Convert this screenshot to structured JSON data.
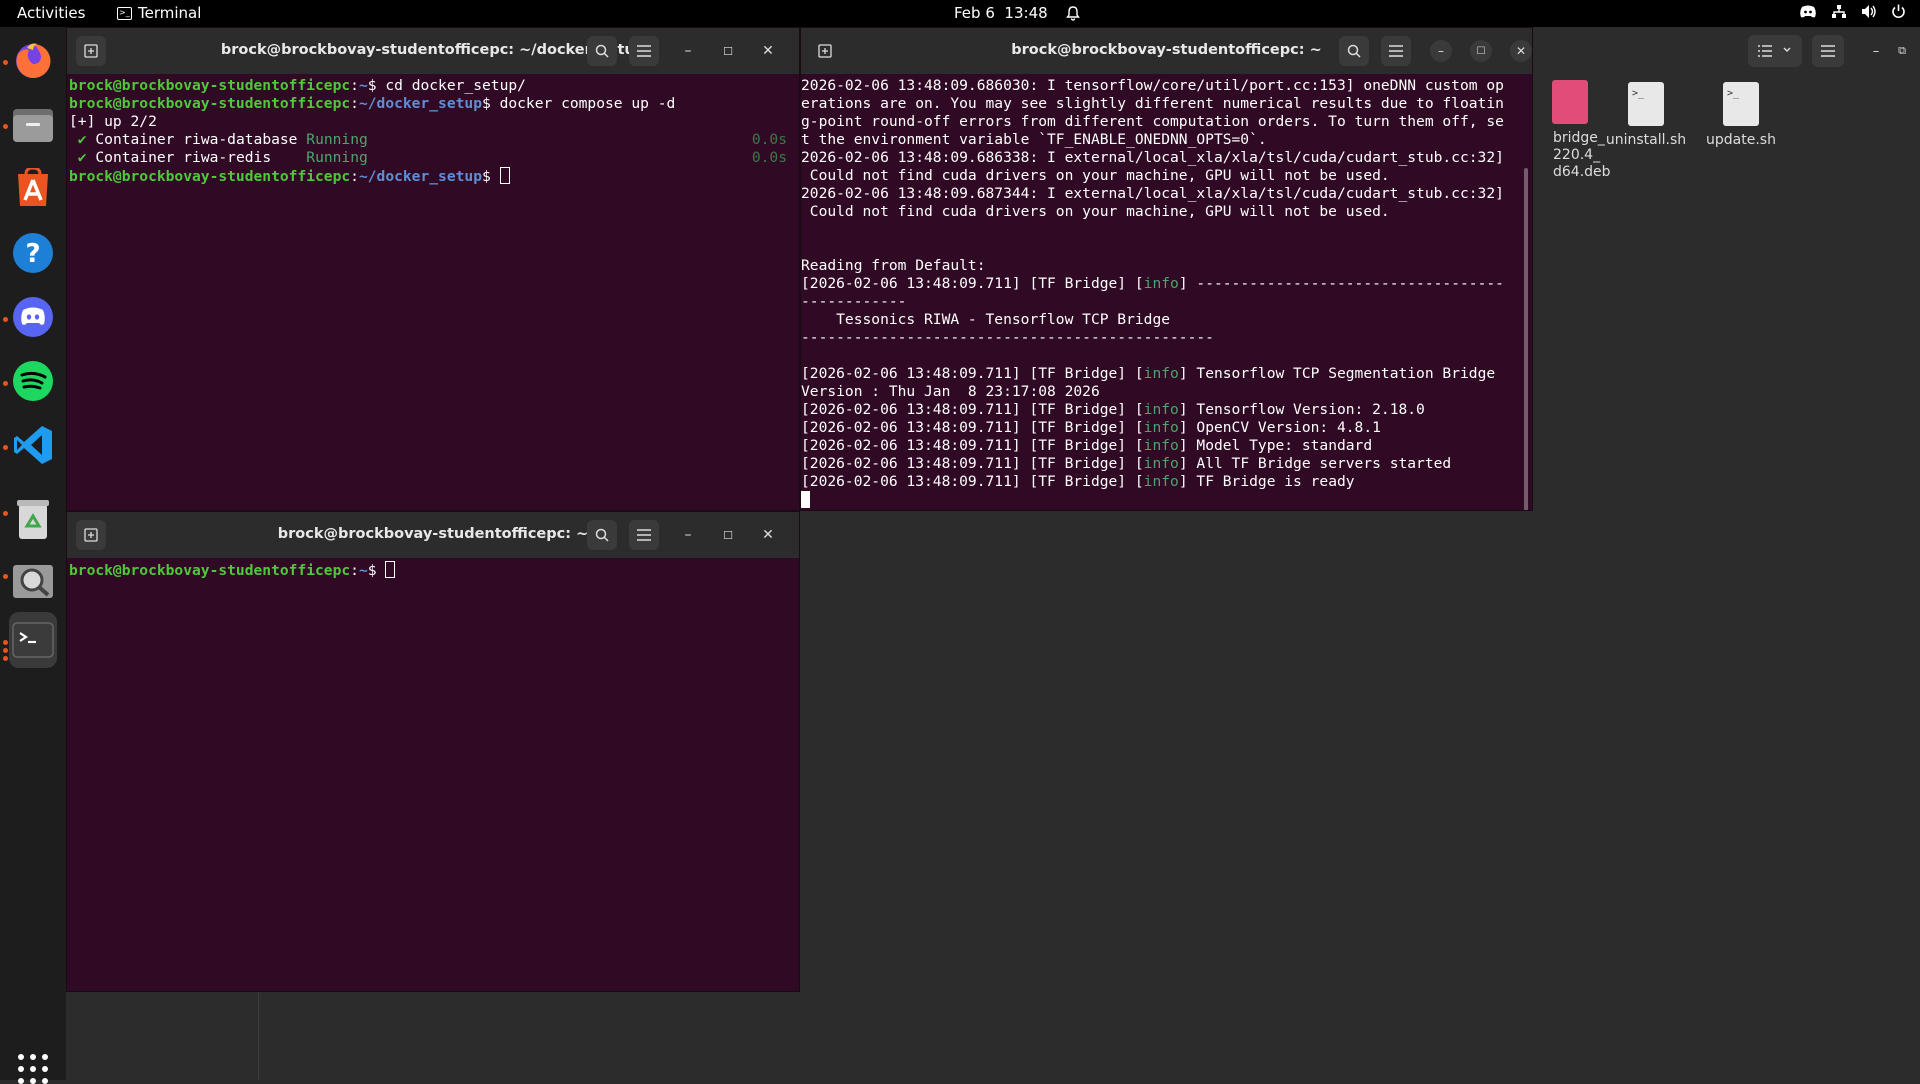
{
  "topbar": {
    "activities": "Activities",
    "app_name": "Terminal",
    "date": "Feb 6",
    "time": "13:48"
  },
  "dock": {
    "apps": [
      "firefox-icon",
      "files-icon",
      "software-icon",
      "help-icon",
      "discord-icon",
      "spotify-icon",
      "vscode-icon",
      "trash-icon",
      "image-viewer-icon",
      "terminal-icon"
    ]
  },
  "files": {
    "desktop_files": [
      {
        "name_lines": [
          "bridge_",
          "220.4_",
          "d64.deb"
        ]
      },
      {
        "name": "uninstall.sh"
      },
      {
        "name": "update.sh"
      }
    ]
  },
  "term1": {
    "title": "brock@brockbovay-studentofficepc: ~/docker_setup",
    "user": "brock@brockbovay-studentofficepc",
    "path_home": "~",
    "path_dir": "~/docker_setup",
    "cmd1": "cd docker_setup/",
    "cmd2": "docker compose up -d",
    "status": "[+] up 2/2",
    "containers": [
      {
        "name": "Container riwa-database",
        "state": "Running",
        "time": "0.0s"
      },
      {
        "name": "Container riwa-redis",
        "state": "Running",
        "time": "0.0s"
      }
    ]
  },
  "term2": {
    "title": "brock@brockbovay-studentofficepc: ~",
    "lines": [
      "2026-02-06 13:48:09.686030: I tensorflow/core/util/port.cc:153] oneDNN custom op",
      "erations are on. You may see slightly different numerical results due to floatin",
      "g-point round-off errors from different computation orders. To turn them off, se",
      "t the environment variable `TF_ENABLE_ONEDNN_OPTS=0`.",
      "2026-02-06 13:48:09.686338: I external/local_xla/xla/tsl/cuda/cudart_stub.cc:32]",
      " Could not find cuda drivers on your machine, GPU will not be used.",
      "2026-02-06 13:48:09.687344: I external/local_xla/xla/tsl/cuda/cudart_stub.cc:32]",
      " Could not find cuda drivers on your machine, GPU will not be used.",
      "",
      "",
      "Reading from Default:"
    ],
    "log_prefix": "[2026-02-06 13:48:09.711] [TF Bridge] [",
    "log_level": "info",
    "log_suffix": "] ",
    "dashes1": "-----------------------------------",
    "dashes1b": "------------",
    "banner": "    Tessonics RIWA - Tensorflow TCP Bridge",
    "dashes2": "-----------------------------------------------",
    "msgs": [
      "Tensorflow TCP Segmentation Bridge",
      "Tensorflow Version: 2.18.0",
      "OpenCV Version: 4.8.1",
      "Model Type: standard",
      "All TF Bridge servers started",
      "TF Bridge is ready"
    ],
    "version_line": "Version : Thu Jan  8 23:17:08 2026"
  },
  "term3": {
    "title": "brock@brockbovay-studentofficepc: ~",
    "user": "brock@brockbovay-studentofficepc",
    "path": "~"
  },
  "colors": {
    "terminal_bg": "#300a24",
    "prompt_user": "#4ec93a",
    "prompt_path": "#5e8fd6",
    "accent": "#e95420"
  }
}
